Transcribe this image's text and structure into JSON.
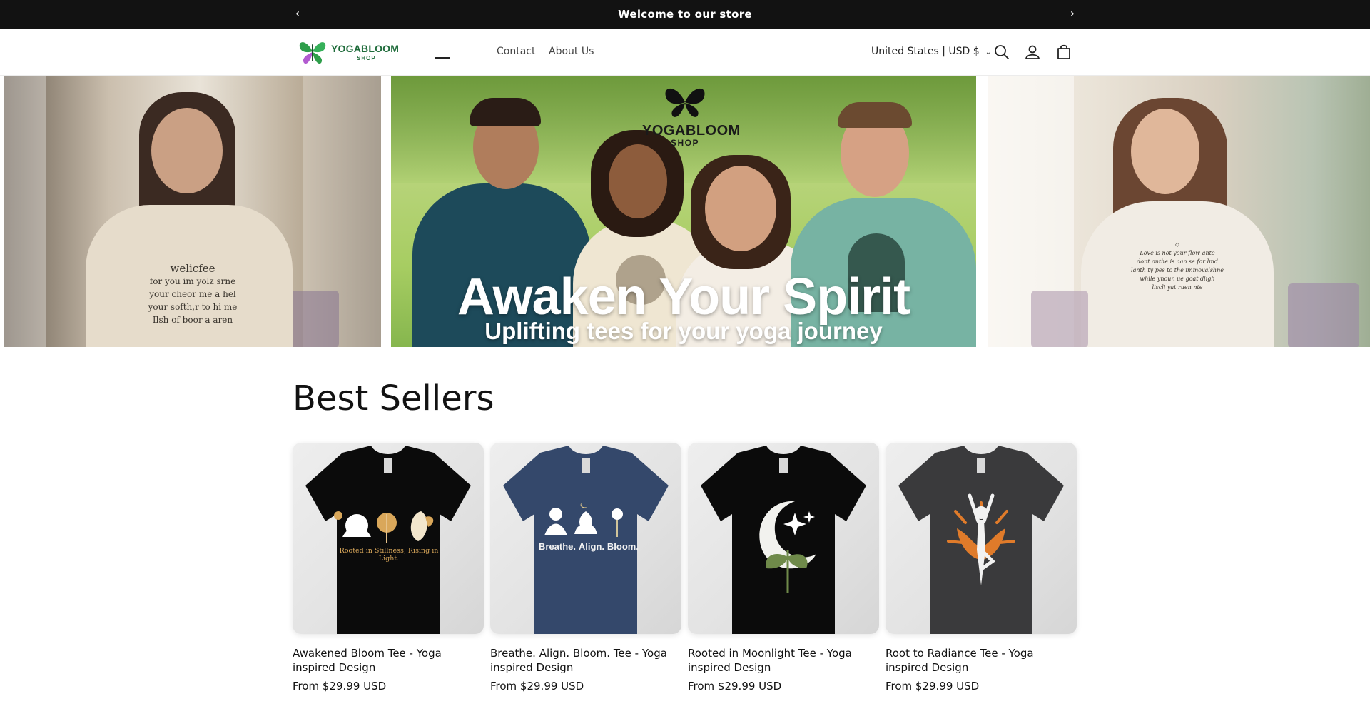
{
  "announcement": {
    "message": "Welcome to our store",
    "prev_icon": "chevron-left-icon",
    "next_icon": "chevron-right-icon"
  },
  "header": {
    "logo": {
      "name": "YOGABLOOM",
      "sub": "SHOP"
    },
    "nav": [
      {
        "label": "Contact"
      },
      {
        "label": "About Us"
      }
    ],
    "locale": "United States | USD $",
    "icons": [
      "search-icon",
      "account-icon",
      "cart-icon"
    ]
  },
  "hero": {
    "logo": {
      "name": "YOGABLOOM",
      "sub": "SHOP"
    },
    "title": "Awaken Your Spirit",
    "subtitle": "Uplifting tees for your yoga journey"
  },
  "best_sellers": {
    "title": "Best Sellers",
    "products": [
      {
        "name": "Awakened Bloom Tee - Yoga inspired Design",
        "price": "From $29.99 USD",
        "shirt_color": "#0b0b0b",
        "graphic_text": "Rooted in Stillness, Rising in Light."
      },
      {
        "name": "Breathe. Align. Bloom. Tee - Yoga inspired Design",
        "price": "From $29.99 USD",
        "shirt_color": "#34486b",
        "graphic_words": [
          "Breathe.",
          "Align.",
          "Bloom."
        ]
      },
      {
        "name": "Rooted in Moonlight Tee - Yoga inspired Design",
        "price": "From $29.99 USD",
        "shirt_color": "#0b0b0b"
      },
      {
        "name": "Root to Radiance Tee - Yoga inspired Design",
        "price": "From $29.99 USD",
        "shirt_color": "#3a3a3c"
      }
    ]
  },
  "colors": {
    "announcement_bg": "#121212",
    "text": "#121212",
    "brand_green": "#1e6b3a",
    "accent_orange": "#e07b2a"
  }
}
